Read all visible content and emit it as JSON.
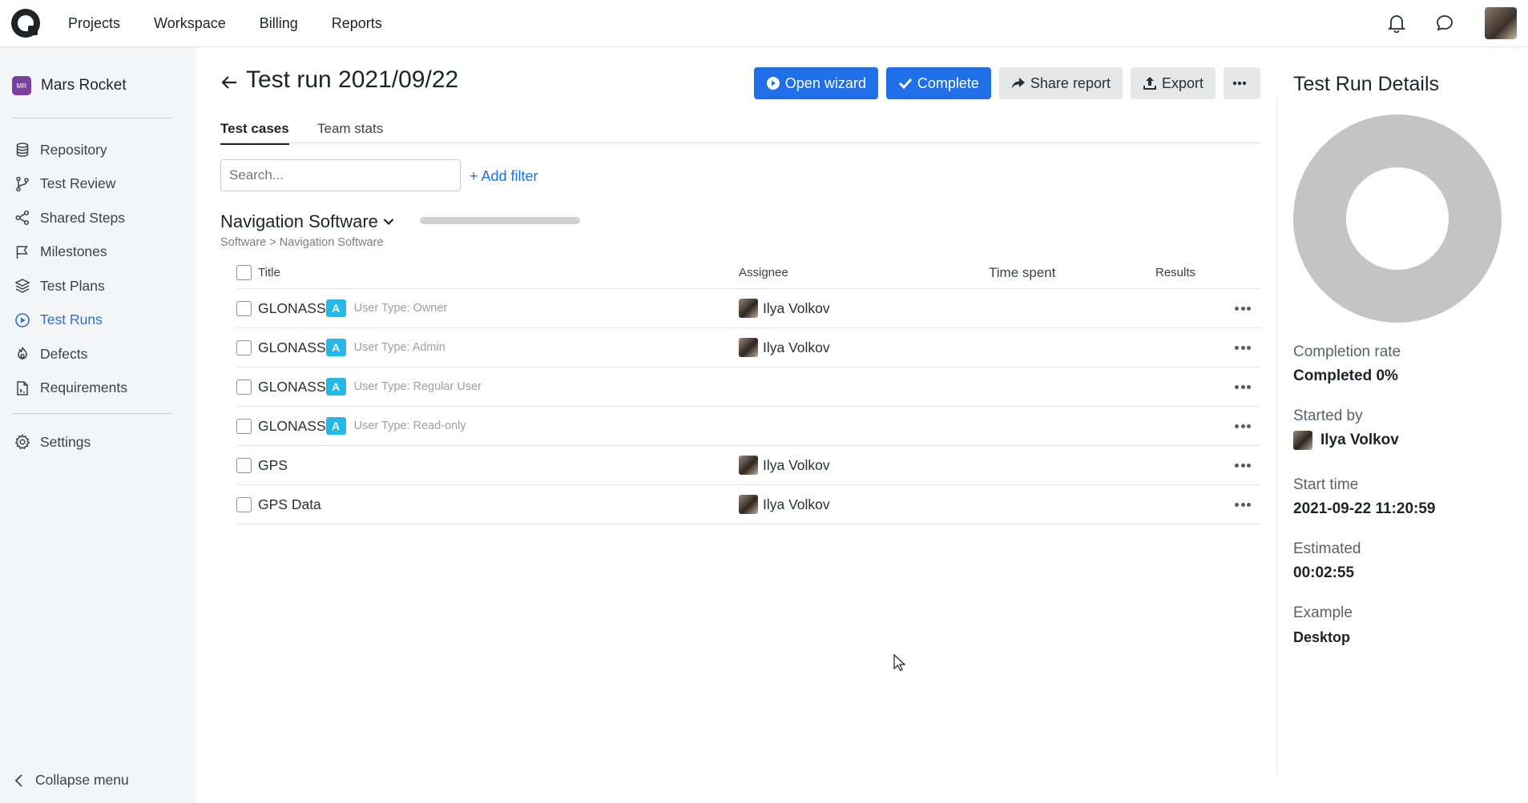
{
  "topbar": {
    "nav": [
      "Projects",
      "Workspace",
      "Billing",
      "Reports"
    ]
  },
  "sidebar": {
    "project_badge": "MR",
    "project_name": "Mars Rocket",
    "items": [
      {
        "label": "Repository",
        "icon": "database-icon"
      },
      {
        "label": "Test Review",
        "icon": "branch-icon"
      },
      {
        "label": "Shared Steps",
        "icon": "share-icon"
      },
      {
        "label": "Milestones",
        "icon": "flag-icon"
      },
      {
        "label": "Test Plans",
        "icon": "layers-icon"
      },
      {
        "label": "Test Runs",
        "icon": "play-circle-icon"
      },
      {
        "label": "Defects",
        "icon": "bug-icon"
      },
      {
        "label": "Requirements",
        "icon": "document-icon"
      }
    ],
    "settings_label": "Settings",
    "collapse_label": "Collapse menu"
  },
  "main": {
    "title": "Test run 2021/09/22",
    "actions": {
      "open_wizard": "Open wizard",
      "complete": "Complete",
      "share_report": "Share report",
      "export": "Export"
    },
    "tabs": [
      "Test cases",
      "Team stats"
    ],
    "search_placeholder": "Search...",
    "add_filter": "+ Add filter",
    "suite_title": "Navigation Software",
    "breadcrumb": "Software > Navigation Software",
    "columns": {
      "title": "Title",
      "assignee": "Assignee",
      "time_spent": "Time spent",
      "results": "Results"
    },
    "rows": [
      {
        "title": "GLONASS",
        "badge": "A",
        "sub": "User Type: Owner",
        "assignee": "Ilya Volkov"
      },
      {
        "title": "GLONASS",
        "badge": "A",
        "sub": "User Type: Admin",
        "assignee": "Ilya Volkov"
      },
      {
        "title": "GLONASS",
        "badge": "A",
        "sub": "User Type: Regular User",
        "assignee": ""
      },
      {
        "title": "GLONASS",
        "badge": "A",
        "sub": "User Type: Read-only",
        "assignee": ""
      },
      {
        "title": "GPS",
        "badge": "",
        "sub": "",
        "assignee": "Ilya Volkov"
      },
      {
        "title": "GPS Data",
        "badge": "",
        "sub": "",
        "assignee": "Ilya Volkov"
      }
    ]
  },
  "details": {
    "title": "Test Run Details",
    "completion_rate_label": "Completion rate",
    "completion_rate_value": "Completed 0%",
    "started_by_label": "Started by",
    "started_by_value": "Ilya Volkov",
    "start_time_label": "Start time",
    "start_time_value": "2021-09-22 11:20:59",
    "estimated_label": "Estimated",
    "estimated_value": "00:02:55",
    "example_label": "Example",
    "example_value": "Desktop"
  },
  "colors": {
    "primary": "#1e6fe8",
    "active_nav": "#2b6fd9",
    "badge": "#22b8e8",
    "donut": "#c4c4c4"
  }
}
